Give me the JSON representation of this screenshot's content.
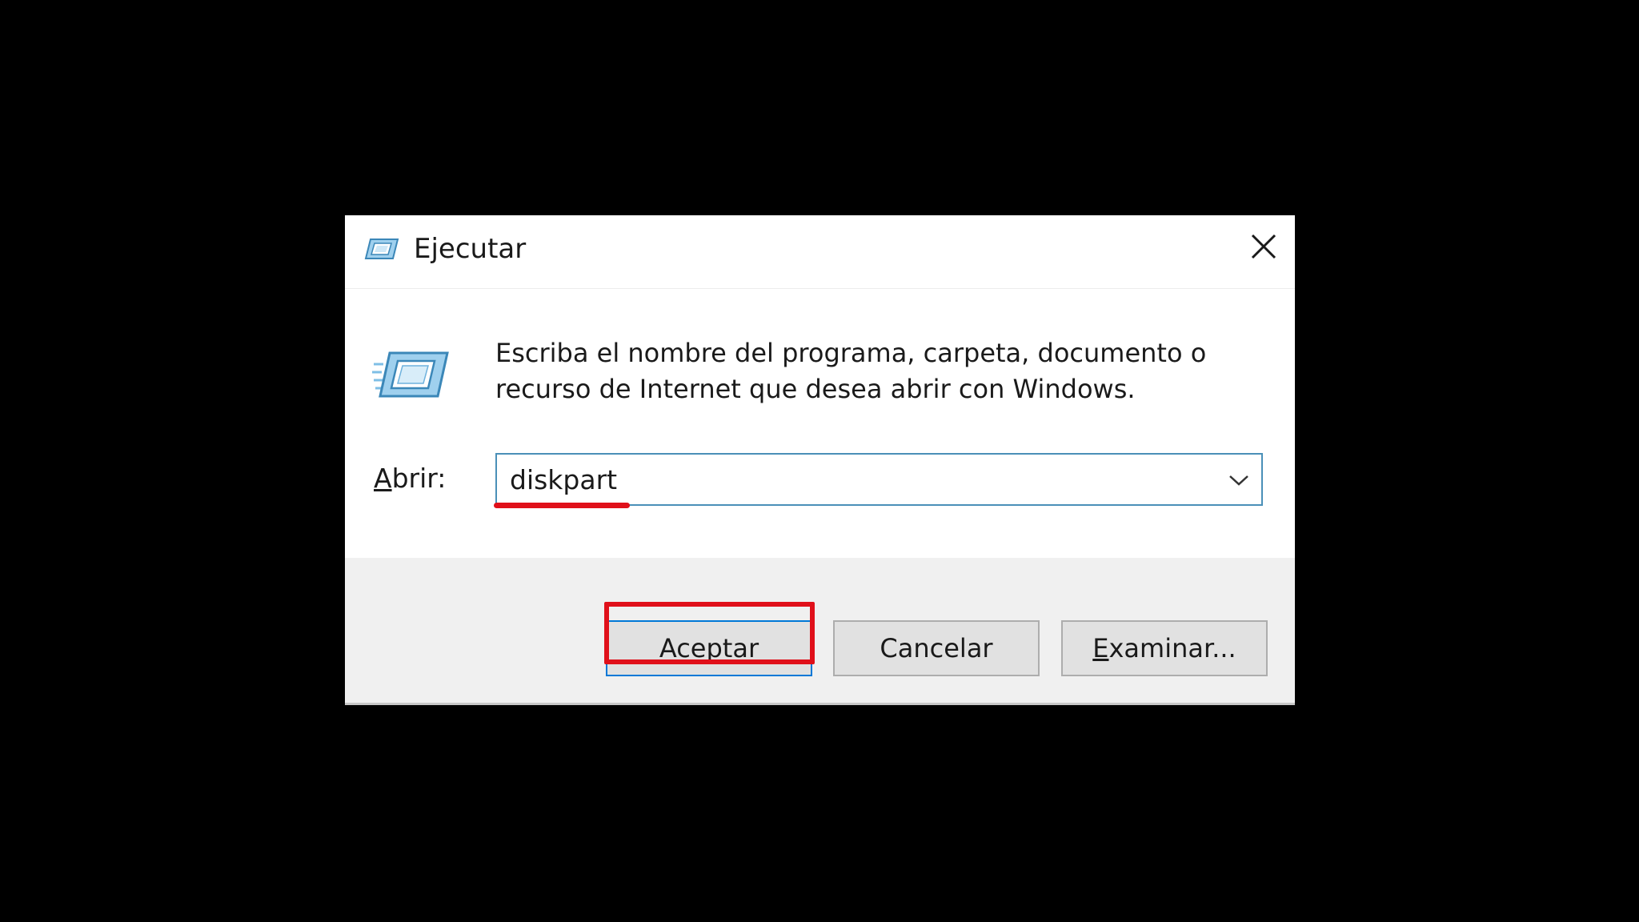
{
  "window": {
    "title": "Ejecutar"
  },
  "body": {
    "instruction_line1": "Escriba el nombre del programa, carpeta, documento o",
    "instruction_line2": "recurso de Internet que desea abrir con Windows.",
    "open_label_accel": "A",
    "open_label_rest": "brir:",
    "open_value": "diskpart"
  },
  "buttons": {
    "accept_label": "Aceptar",
    "cancel_label": "Cancelar",
    "browse_accel": "E",
    "browse_rest": "xaminar..."
  },
  "icons": {
    "title_icon": "run-icon",
    "body_icon": "run-icon",
    "close": "close-icon",
    "dropdown": "chevron-down-icon"
  },
  "colors": {
    "background": "#000000",
    "dialog": "#ffffff",
    "footer": "#f0f0f0",
    "input_border": "#4a90b8",
    "annotation": "#e0101a",
    "focus_border": "#0078d7"
  }
}
